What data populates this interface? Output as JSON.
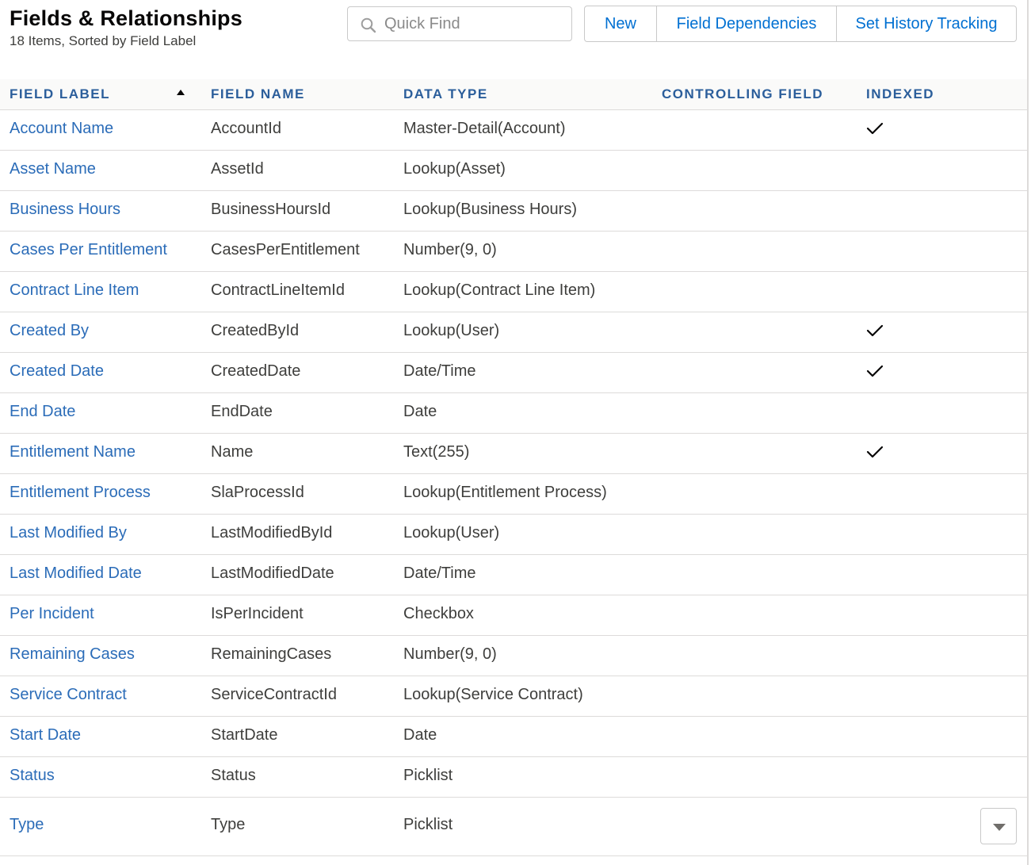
{
  "header": {
    "title": "Fields & Relationships",
    "subtitle": "18 Items, Sorted by Field Label",
    "search_placeholder": "Quick Find",
    "buttons": {
      "new": "New",
      "field_dependencies": "Field Dependencies",
      "history_tracking": "Set History Tracking"
    }
  },
  "table": {
    "columns": {
      "field_label": "FIELD LABEL",
      "field_name": "FIELD NAME",
      "data_type": "DATA TYPE",
      "controlling_field": "CONTROLLING FIELD",
      "indexed": "INDEXED"
    },
    "sorted_by": "field_label",
    "sort_direction": "ascending",
    "rows": [
      {
        "label": "Account Name",
        "name": "AccountId",
        "type": "Master-Detail(Account)",
        "controlling": "",
        "indexed": true
      },
      {
        "label": "Asset Name",
        "name": "AssetId",
        "type": "Lookup(Asset)",
        "controlling": "",
        "indexed": false
      },
      {
        "label": "Business Hours",
        "name": "BusinessHoursId",
        "type": "Lookup(Business Hours)",
        "controlling": "",
        "indexed": false
      },
      {
        "label": "Cases Per Entitlement",
        "name": "CasesPerEntitlement",
        "type": "Number(9, 0)",
        "controlling": "",
        "indexed": false
      },
      {
        "label": "Contract Line Item",
        "name": "ContractLineItemId",
        "type": "Lookup(Contract Line Item)",
        "controlling": "",
        "indexed": false
      },
      {
        "label": "Created By",
        "name": "CreatedById",
        "type": "Lookup(User)",
        "controlling": "",
        "indexed": true
      },
      {
        "label": "Created Date",
        "name": "CreatedDate",
        "type": "Date/Time",
        "controlling": "",
        "indexed": true
      },
      {
        "label": "End Date",
        "name": "EndDate",
        "type": "Date",
        "controlling": "",
        "indexed": false
      },
      {
        "label": "Entitlement Name",
        "name": "Name",
        "type": "Text(255)",
        "controlling": "",
        "indexed": true
      },
      {
        "label": "Entitlement Process",
        "name": "SlaProcessId",
        "type": "Lookup(Entitlement Process)",
        "controlling": "",
        "indexed": false
      },
      {
        "label": "Last Modified By",
        "name": "LastModifiedById",
        "type": "Lookup(User)",
        "controlling": "",
        "indexed": false
      },
      {
        "label": "Last Modified Date",
        "name": "LastModifiedDate",
        "type": "Date/Time",
        "controlling": "",
        "indexed": false
      },
      {
        "label": "Per Incident",
        "name": "IsPerIncident",
        "type": "Checkbox",
        "controlling": "",
        "indexed": false
      },
      {
        "label": "Remaining Cases",
        "name": "RemainingCases",
        "type": "Number(9, 0)",
        "controlling": "",
        "indexed": false
      },
      {
        "label": "Service Contract",
        "name": "ServiceContractId",
        "type": "Lookup(Service Contract)",
        "controlling": "",
        "indexed": false
      },
      {
        "label": "Start Date",
        "name": "StartDate",
        "type": "Date",
        "controlling": "",
        "indexed": false
      },
      {
        "label": "Status",
        "name": "Status",
        "type": "Picklist",
        "controlling": "",
        "indexed": false
      },
      {
        "label": "Type",
        "name": "Type",
        "type": "Picklist",
        "controlling": "",
        "indexed": false,
        "has_row_menu": true
      }
    ]
  },
  "icons": {
    "search": "search-icon",
    "sort": "sort-ascending-icon",
    "indexed": "checkmark-icon",
    "row_menu": "chevron-down-icon"
  },
  "colors": {
    "link": "#2b6cb8",
    "header_text": "#2b5e9b",
    "button_text": "#0070d2",
    "border": "#dddbda"
  }
}
